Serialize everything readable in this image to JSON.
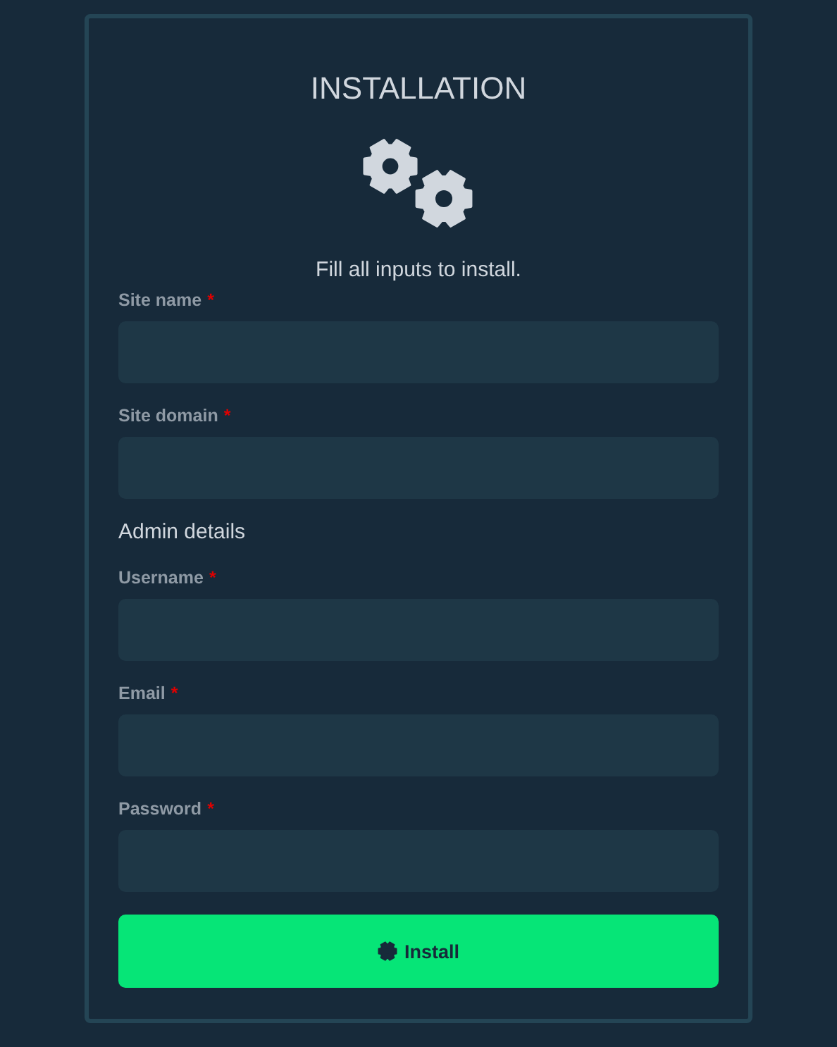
{
  "title": "INSTALLATION",
  "subtitle": "Fill all inputs to install.",
  "site_fields": [
    {
      "label": "Site name",
      "required_mark": "*"
    },
    {
      "label": "Site domain",
      "required_mark": "*"
    }
  ],
  "admin_heading": "Admin details",
  "admin_fields": [
    {
      "label": "Username",
      "required_mark": "*"
    },
    {
      "label": "Email",
      "required_mark": "*"
    },
    {
      "label": "Password",
      "required_mark": "*"
    }
  ],
  "install_button": {
    "label": "Install"
  }
}
